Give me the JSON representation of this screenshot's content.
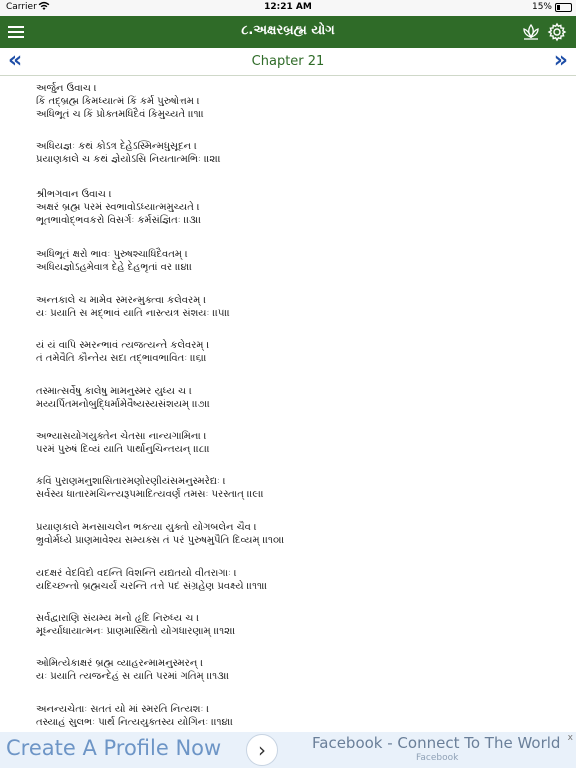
{
  "status_bar": {
    "carrier": "Carrier",
    "time": "12:21 AM",
    "battery": "15%"
  },
  "header": {
    "title": "૮.અક્ષરબ્રહ્મ યોગ",
    "menu_icon": "hamburger-menu-icon",
    "lotus_icon": "lotus-icon",
    "settings_icon": "gear-icon",
    "color": "#2f6b28"
  },
  "chapter_nav": {
    "title": "Chapter 21",
    "prev": "«",
    "next": "»",
    "arrow_color": "#1f4fa8"
  },
  "verses": [
    {
      "lines": [
        "અર્જુન ઉવાચ ।",
        "કિં તદ્બ્રહ્મ કિમધ્યાત્મં કિં કર્મ પુરુષોત્તમ    ।",
        "અધિભૂતં ચ કિં પ્રોક્તમધિદૈવં કિમુચ્યતે ।।૧।।"
      ]
    },
    {
      "lines": [
        "અધિયજ્ઞઃ કથં કોઽત્ર દેહેઽસ્મિન્મધુસૂદન    ।",
        "પ્રયાણકાલે ચ કથં જ્ઞેયોઽસિ નિયતાત્મભિઃ   ।।૨।।"
      ]
    },
    {
      "lines": [
        "શ્રીભગવાન ઉવાચ ।",
        "અક્ષરં બ્રહ્મ પરમં સ્વભાવોઽધ્યાત્મમુચ્યતે    ।",
        "ભૂતભાવોદ્ભવકરો વિસર્ગઃ કર્મસંજ્ઞિતઃ ।।૩।।"
      ]
    },
    {
      "lines": [
        "અધિભૂતં ક્ષરો ભાવઃ પુરુષશ્ચાધિદૈવતમ્    ।",
        "અધિયજ્ઞોઽહમેવાત્ર દેહે દેહભૃતાં વર    ।।૪।।"
      ]
    },
    {
      "lines": [
        "અન્તકાલે ચ મામેવ સ્મરન્મુક્ત્વા કલેવરમ્  ।",
        "યઃ પ્રયાતિ સ મદ્ભાવં યાતિ નાસ્ત્યત્ર સંશયઃ    ।।૫।।"
      ]
    },
    {
      "lines": [
        "યં યં વાપિ સ્મરન્ભાવં ત્યજત્યન્તે કલેવરમ્ ।",
        "તં તમેવૈતિ કૌન્તેય સદા તદ્ભાવભાવિતઃ   ।।૬।।"
      ]
    },
    {
      "lines": [
        "તસ્માત્સર્વેષુ કાલેષુ મામનુસ્મર યુધ્ય ચ     ।",
        "મય્યર્પિતમનોબુદ્ધિર્મામેવૈષ્યસ્યસંશયમ્     ।।૭।।"
      ]
    },
    {
      "lines": [
        "અભ્યાસયોગયુક્તેન ચેતસા નાન્યગામિના     ।",
        "પરમં પુરુષં દિવ્યં યાતિ પાર્થાનુચિન્તયન્   ।।૮।।"
      ]
    },
    {
      "lines": [
        "કવિં પુરાણમનુશાસિતારમણોરણીયંસમનુસ્મરેદ્યઃ   ।",
        "સર્વસ્ય ધાતારમચિન્ત્યરૂપમાદિત્યવર્ણં તમસઃ પરસ્તાત્    ।।૯।।"
      ]
    },
    {
      "lines": [
        "પ્રયાણકાલે મનસાચલેન ભક્ત્યા યુક્તો યોગબલેન ચૈવ     ।",
        "ભ્રુવોર્મધ્યે પ્રાણમાવેશ્ય સમ્યક્સ તં પરં પુરુષમુપૈતિ દિવ્યમ્   ।।૧૦।।"
      ]
    },
    {
      "lines": [
        "યદક્ષરં વેદવિદો વદન્તિ વિશન્તિ યદ્યતયો વીતરાગાઃ  ।",
        "યદિચ્છન્તો બ્રહ્મચર્યં ચરન્તિ તત્તે પદં સંગ્રહેણ પ્રવક્ષ્યે      ।।૧૧।।"
      ]
    },
    {
      "lines": [
        "સર્વદ્વારાણિ સંયમ્ય મનો હૃદિ નિરુધ્ય ચ    ।",
        "મૂર્ધ્ન્યાધાયાત્મનઃ પ્રાણમાસ્થિતો યોગધારણામ્   ।।૧૨।।"
      ]
    },
    {
      "lines": [
        "ઓમિત્યેકાક્ષરં બ્રહ્મ વ્યાહરન્મામનુસ્મરન્   ।",
        "યઃ પ્રયાતિ ત્યજન્દેહં સ યાતિ પરમાં ગતિમ્ ।।૧૩।।"
      ]
    },
    {
      "lines": [
        "અનન્યચેતાઃ સતતં યો માં સ્મરતિ નિત્યશઃ  ।",
        "તસ્યાહં સુલભઃ પાર્થ નિત્યયુક્તસ્ય યોગિનઃ ।।૧૪।।"
      ]
    }
  ],
  "ad": {
    "left_text": "Create A Profile Now",
    "arrow": "›",
    "right_title": "Facebook - Connect To The World",
    "right_sub": "Facebook",
    "close": "x"
  }
}
